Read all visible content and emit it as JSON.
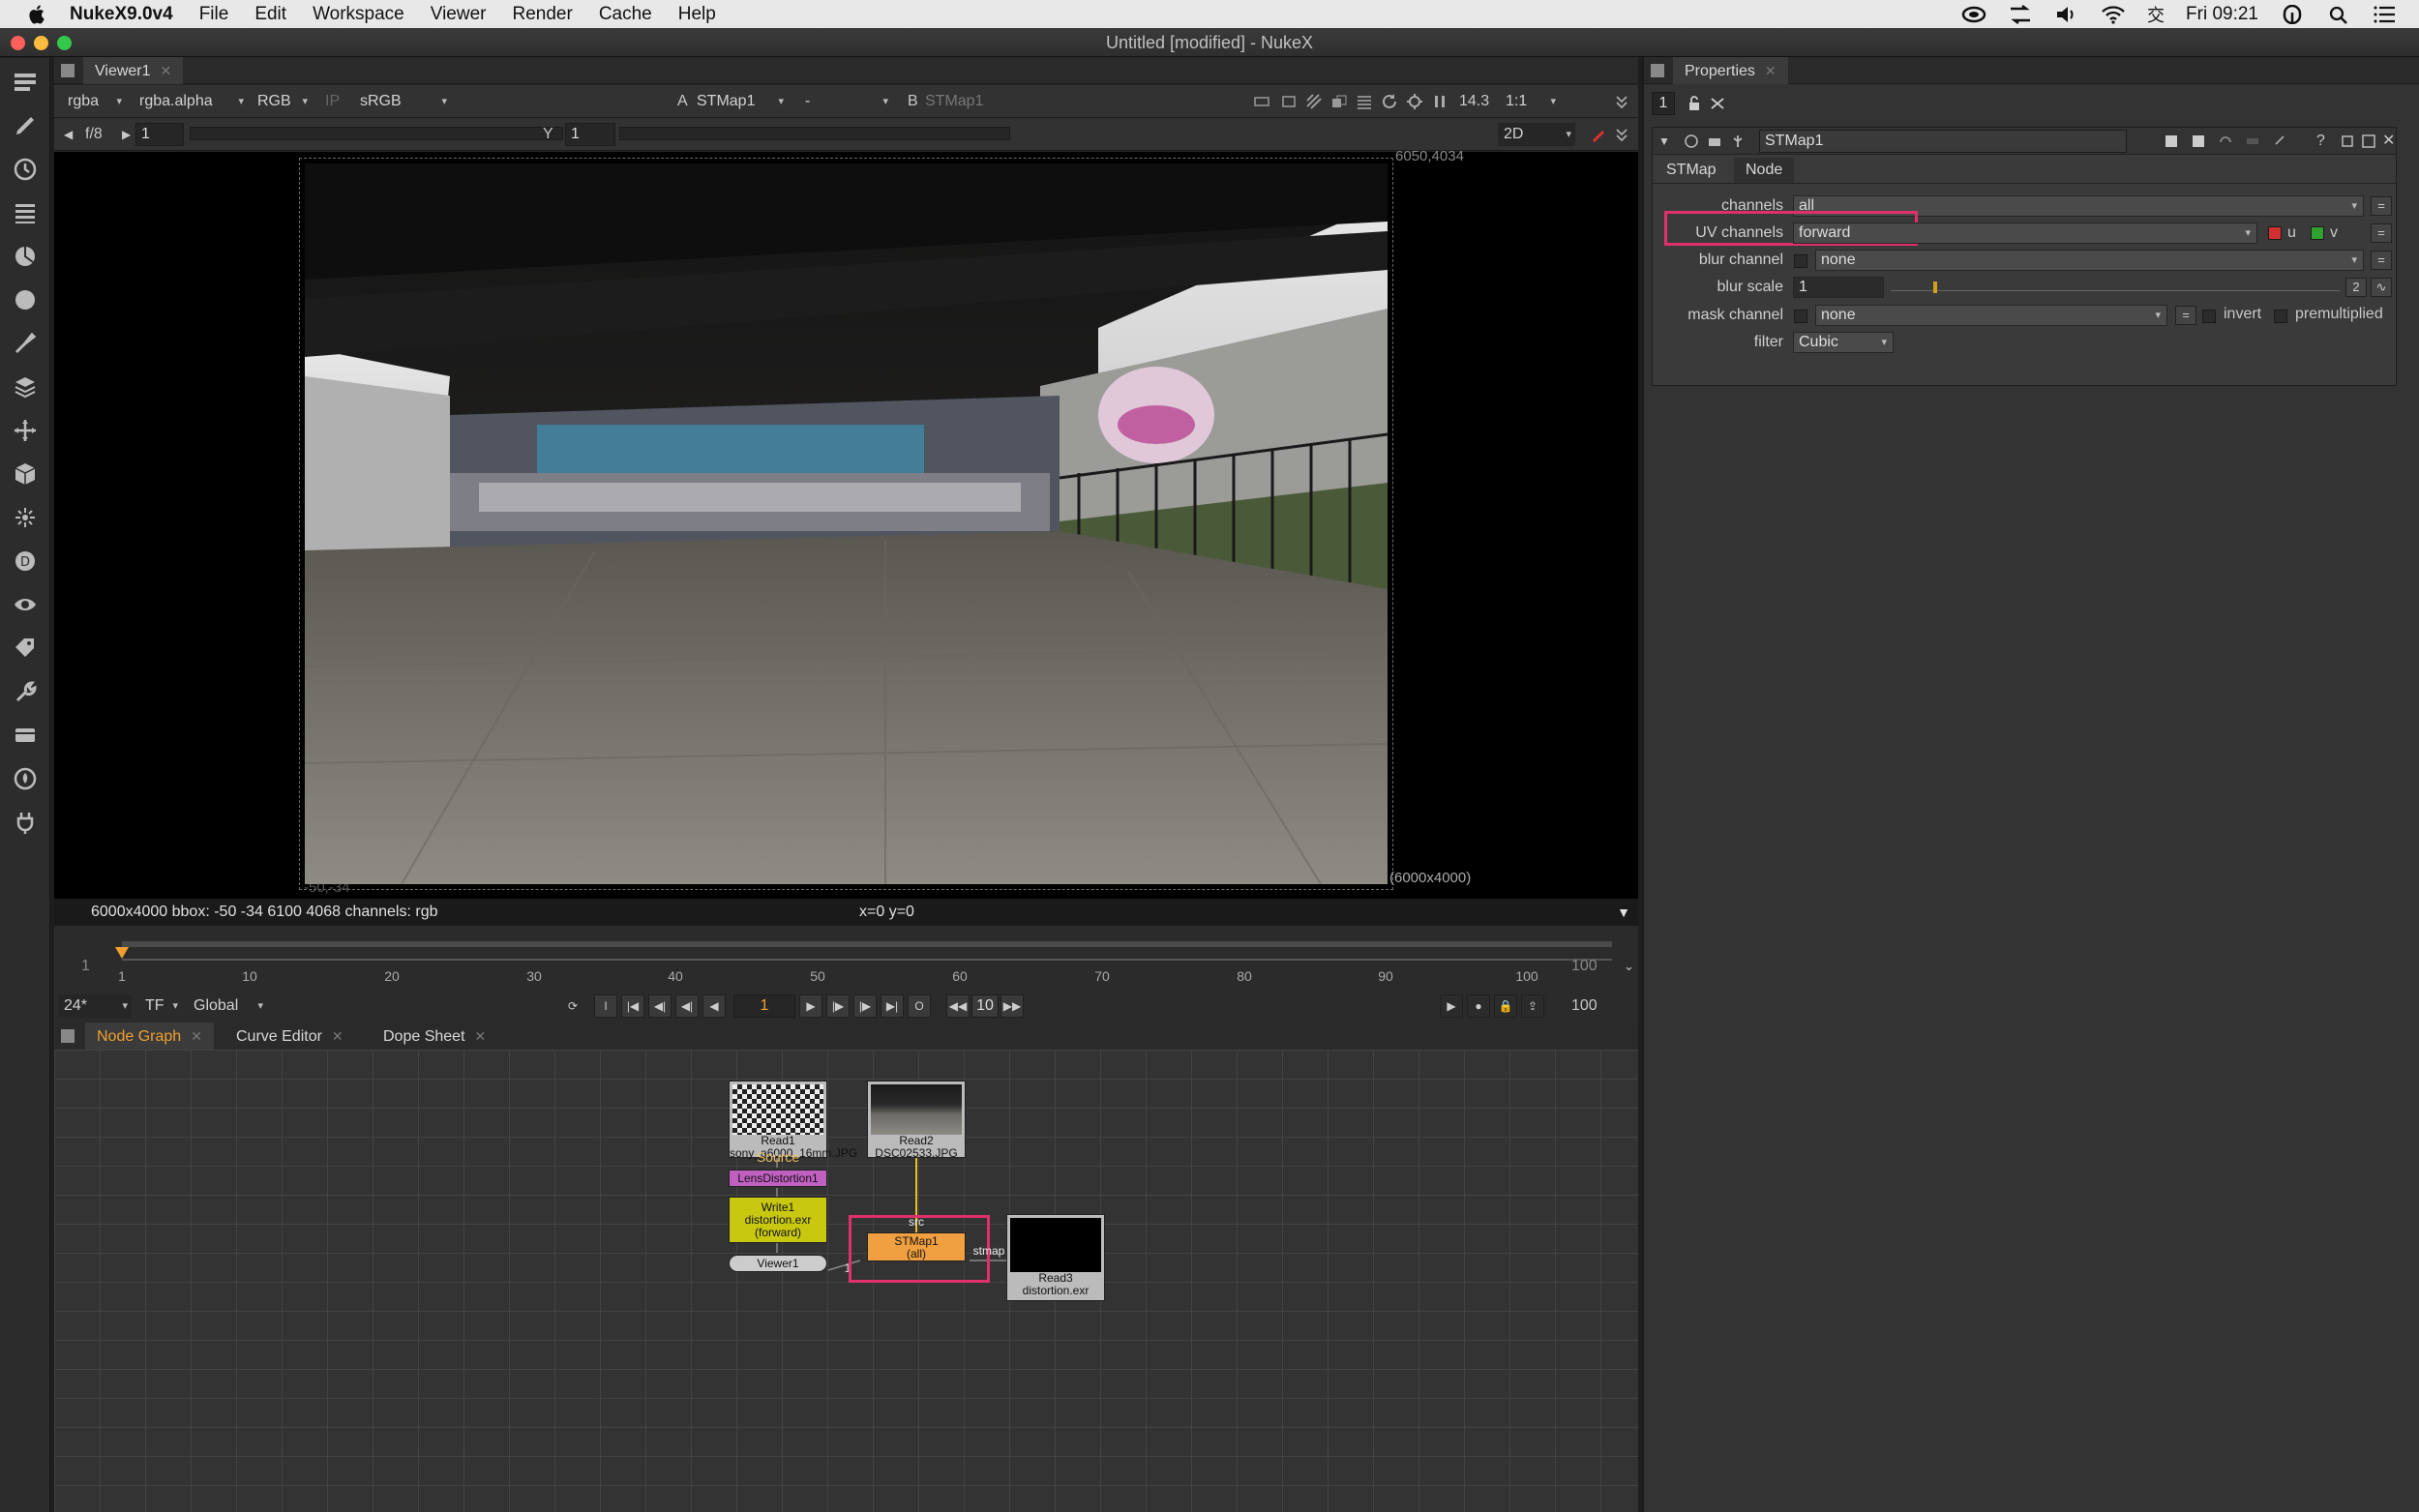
{
  "menubar": {
    "app": "NukeX9.0v4",
    "items": [
      "File",
      "Edit",
      "Workspace",
      "Viewer",
      "Render",
      "Cache",
      "Help"
    ],
    "clock": "Fri 09:21"
  },
  "window": {
    "title": "Untitled [modified] - NukeX"
  },
  "viewer": {
    "tab": "Viewer1",
    "channels": "rgba",
    "alpha": "rgba.alpha",
    "colorspace_display": "RGB",
    "ip": "IP",
    "lut": "sRGB",
    "input_a_label": "A",
    "input_a": "STMap1",
    "wipe_op": "-",
    "input_b_label": "B",
    "input_b": "STMap1",
    "gain_label": "f/8",
    "gain_value": "1",
    "gamma_label": "Y",
    "gamma_value": "1",
    "zoom_value": "14.3",
    "proxy_ratio": "1:1",
    "view_mode": "2D",
    "format_tl": "6050,4034",
    "format_bl": "-50,-34",
    "format_res": "(6000x4000)",
    "info_left": "6000x4000  bbox: -50 -34 6100 4068 channels: rgb",
    "info_center": "x=0 y=0"
  },
  "timeline": {
    "start": "1",
    "end": "100",
    "end_right": "100",
    "ticks": [
      "1",
      "10",
      "20",
      "30",
      "40",
      "50",
      "60",
      "70",
      "80",
      "90",
      "100"
    ],
    "fps": "24*",
    "tf": "TF",
    "scope": "Global",
    "current_frame": "1",
    "step": "10",
    "out_frame": "100",
    "i_label": "I",
    "o_label": "O"
  },
  "nodegraph": {
    "tabs": [
      "Node Graph",
      "Curve Editor",
      "Dope Sheet"
    ],
    "nodes": {
      "read1_name": "Read1",
      "read1_file": "sony_a6000_16mm.JPG",
      "read2_name": "Read2",
      "read2_file": "DSC02533.JPG",
      "source_label": "Source",
      "lensdist": "LensDistortion1",
      "write1_name": "Write1",
      "write1_file": "distortion.exr",
      "write1_mode": "(forward)",
      "viewer1": "Viewer1",
      "stmap_name": "STMap1",
      "stmap_ch": "(all)",
      "stmap_src": "src",
      "stmap_in": "stmap",
      "read3_name": "Read3",
      "read3_file": "distortion.exr",
      "pipe_num": "1"
    }
  },
  "properties": {
    "tab": "Properties",
    "max_panels": "1",
    "node_name": "STMap1",
    "tabs": [
      "STMap",
      "Node"
    ],
    "channels_label": "channels",
    "channels_value": "all",
    "uv_label": "UV channels",
    "uv_value": "forward",
    "uv_u": "u",
    "uv_v": "v",
    "blur_channel_label": "blur channel",
    "blur_channel_value": "none",
    "blur_scale_label": "blur scale",
    "blur_scale_value": "1",
    "blur_scale_dim": "2",
    "mask_label": "mask channel",
    "mask_value": "none",
    "invert_label": "invert",
    "premult_label": "premultiplied",
    "filter_label": "filter",
    "filter_value": "Cubic"
  },
  "colors": {
    "highlight": "#e0306a",
    "node_orange": "#f0a040",
    "write_yellow": "#c8c810",
    "lens_purple": "#c060c0",
    "pipe_yellow": "#e8c020"
  }
}
